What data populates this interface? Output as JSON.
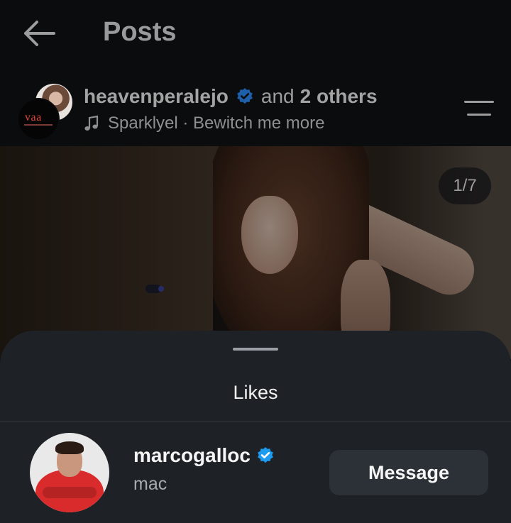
{
  "header": {
    "title": "Posts",
    "back_icon": "arrow-left-icon"
  },
  "post": {
    "author": "heavenperalejo",
    "and_text": "and",
    "others": "2 others",
    "music": "Sparklyel · Bewitch me more",
    "co_author_logo": "vaa",
    "counter": "1/7"
  },
  "likes_sheet": {
    "title": "Likes",
    "users": [
      {
        "username": "marcogalloc",
        "name": "mac",
        "button": "Message",
        "verified": true
      }
    ]
  },
  "colors": {
    "verified": "#1d9bf0",
    "sheet_bg": "#1e2226",
    "button_bg": "#2c3137"
  }
}
